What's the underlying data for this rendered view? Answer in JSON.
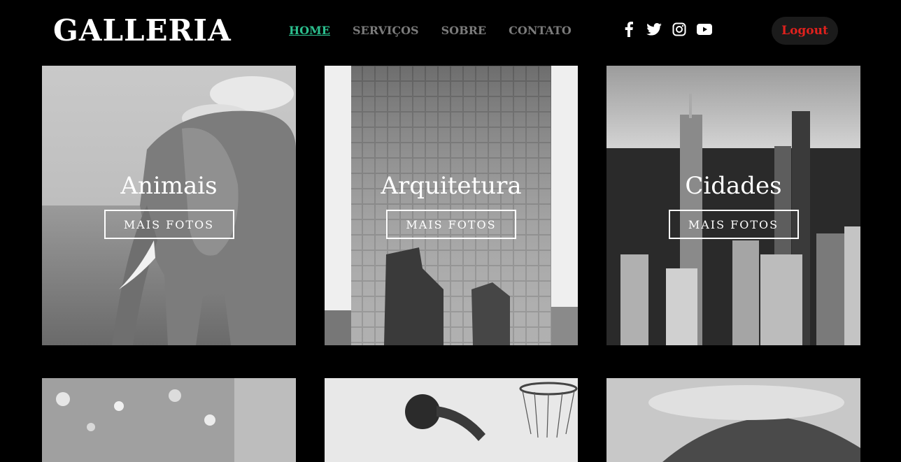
{
  "header": {
    "logo": "GALLERIA",
    "nav": [
      "HOME",
      "SERVIÇOS",
      "SOBRE",
      "CONTATO"
    ],
    "active_nav": "HOME",
    "social_icons": [
      "facebook-icon",
      "twitter-icon",
      "instagram-icon",
      "youtube-icon"
    ],
    "logout_label": "Logout"
  },
  "gallery": {
    "cards": [
      {
        "title": "Animais",
        "button": "MAIS FOTOS"
      },
      {
        "title": "Arquitetura",
        "button": "MAIS FOTOS"
      },
      {
        "title": "Cidades",
        "button": "MAIS FOTOS"
      }
    ]
  },
  "colors": {
    "background": "#000000",
    "nav_active": "#2cbf8e",
    "nav_inactive": "#7b7b7b",
    "logout_text": "#e0211d",
    "logout_bg": "#1b1b1b"
  }
}
